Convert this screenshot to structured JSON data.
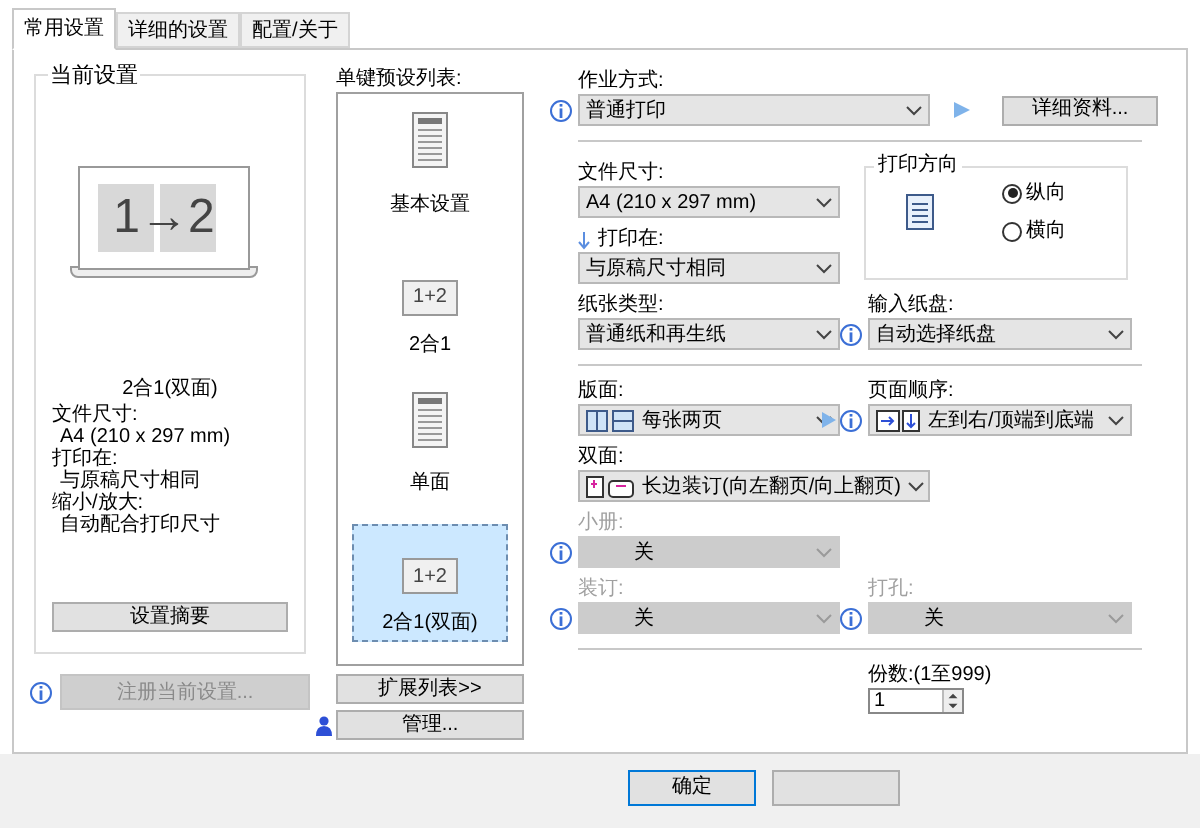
{
  "tabs": [
    {
      "label": "常用设置",
      "selected": true
    },
    {
      "label": "详细的设置",
      "selected": false
    },
    {
      "label": "配置/关于",
      "selected": false
    }
  ],
  "current_settings": {
    "title": "当前设置",
    "illustration_text": "1→2",
    "caption": "2合1(双面)",
    "details": [
      {
        "label": "文件尺寸:",
        "value": "A4 (210 x 297 mm)"
      },
      {
        "label": "打印在:",
        "value": "与原稿尺寸相同"
      },
      {
        "label": "缩小/放大:",
        "value": "自动配合打印尺寸"
      }
    ],
    "summary_button": "设置摘要",
    "register_button": {
      "label": "注册当前设置...",
      "disabled": true
    }
  },
  "presets": {
    "title": "单键预设列表:",
    "items": [
      {
        "kind": "document",
        "label": "基本设置",
        "selected": false
      },
      {
        "kind": "n_up",
        "icon_text": "1+2",
        "label": "2合1",
        "selected": false
      },
      {
        "kind": "document",
        "label": "单面",
        "selected": false
      },
      {
        "kind": "n_up",
        "icon_text": "1+2",
        "label": "2合1(双面)",
        "selected": true
      }
    ],
    "expand_button": "扩展列表>>",
    "manage_button": "管理..."
  },
  "job_mode": {
    "label": "作业方式:",
    "value": "普通打印",
    "details_button": "详细资料..."
  },
  "paper_size": {
    "label": "文件尺寸:",
    "value": "A4 (210 x 297 mm)"
  },
  "print_on": {
    "label": "打印在:",
    "value": "与原稿尺寸相同"
  },
  "orientation": {
    "title": "打印方向",
    "options": [
      {
        "label": "纵向",
        "selected": true
      },
      {
        "label": "横向",
        "selected": false
      }
    ]
  },
  "paper_type": {
    "label": "纸张类型:",
    "value": "普通纸和再生纸"
  },
  "input_tray": {
    "label": "输入纸盘:",
    "value": "自动选择纸盘"
  },
  "layout": {
    "label": "版面:",
    "value": "每张两页"
  },
  "page_order": {
    "label": "页面顺序:",
    "value": "左到右/顶端到底端"
  },
  "duplex": {
    "label": "双面:",
    "value": "长边装订(向左翻页/向上翻页)"
  },
  "booklet": {
    "label": "小册:",
    "value": "关",
    "disabled": true
  },
  "binding": {
    "label": "装订:",
    "value": "关",
    "disabled": true
  },
  "punch": {
    "label": "打孔:",
    "value": "关",
    "disabled": true
  },
  "copies": {
    "label": "份数:(1至999)",
    "value": "1"
  },
  "ok_button": "确定"
}
